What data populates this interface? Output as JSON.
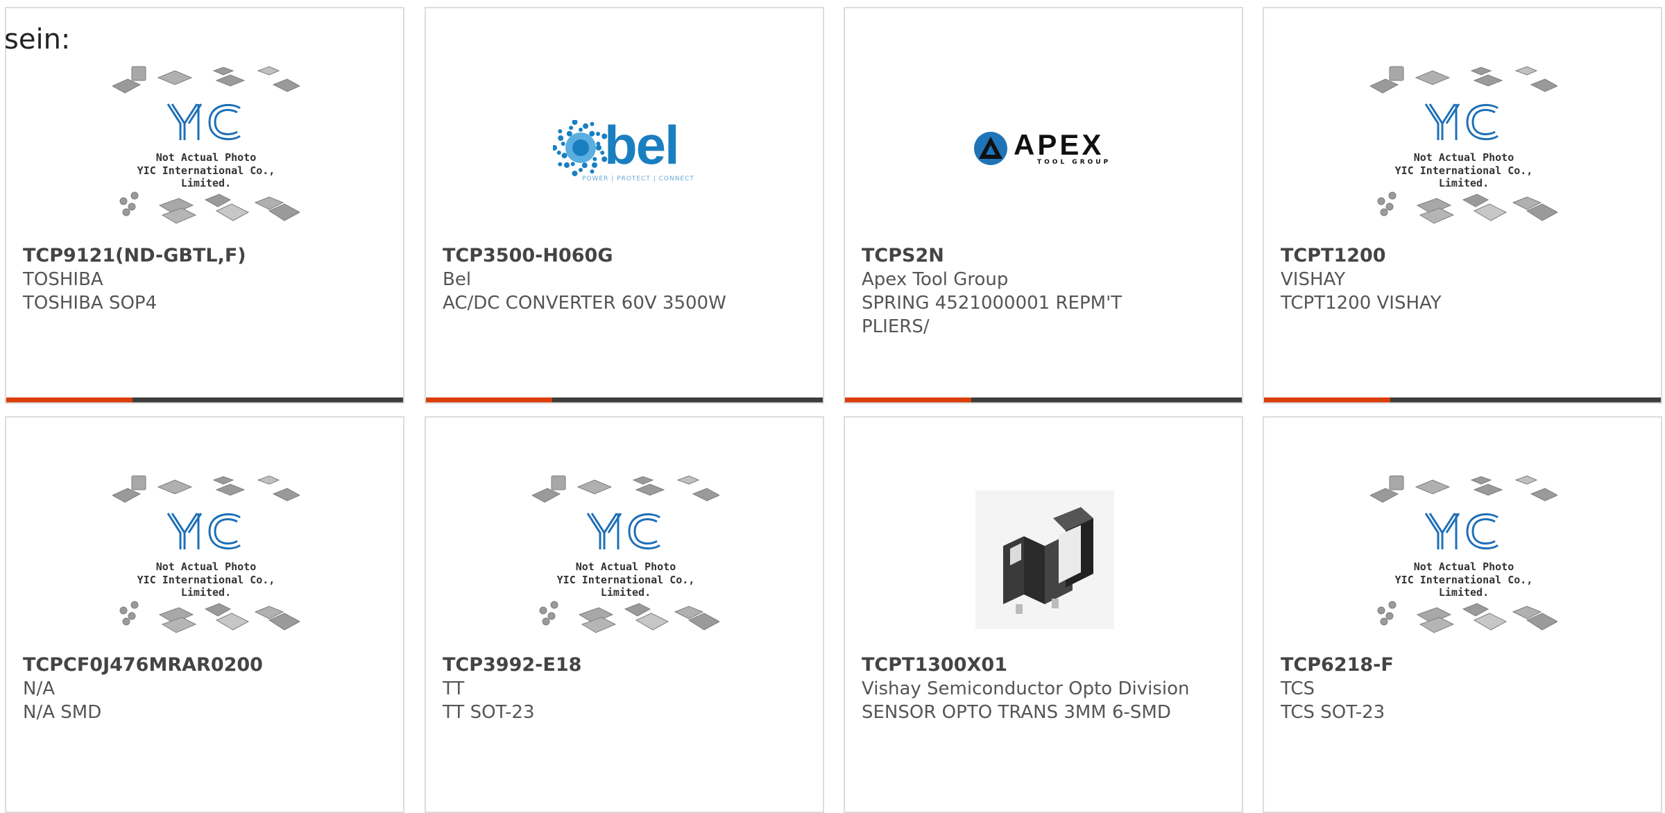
{
  "heading": "sein:",
  "placeholder": {
    "line1": "Not Actual Photo",
    "line2": "YIC International Co., Limited.",
    "logo_text": "YIC"
  },
  "logos": {
    "bel": {
      "word": "bel",
      "tagline": "POWER | PROTECT | CONNECT"
    },
    "apex": {
      "word": "APEX",
      "sub": "TOOL GROUP"
    }
  },
  "colors": {
    "accent": "#d9400b",
    "bar": "#3e3e3e",
    "yic_blue": "#1e6fb8",
    "bel_blue": "#1a7fc1"
  },
  "products": [
    {
      "part": "TCP9121(ND-GBTL,F)",
      "maker": "TOSHIBA",
      "desc": "TOSHIBA SOP4",
      "image": "yic-placeholder"
    },
    {
      "part": "TCP3500-H060G",
      "maker": "Bel",
      "desc": "AC/DC CONVERTER 60V 3500W",
      "image": "bel-logo"
    },
    {
      "part": "TCPS2N",
      "maker": "Apex Tool Group",
      "desc": "SPRING 4521000001 REPM'T PLIERS/",
      "image": "apex-logo"
    },
    {
      "part": "TCPT1200",
      "maker": "VISHAY",
      "desc": "TCPT1200 VISHAY",
      "image": "yic-placeholder"
    },
    {
      "part": "TCPCF0J476MRAR0200",
      "maker": "N/A",
      "desc": "N/A SMD",
      "image": "yic-placeholder"
    },
    {
      "part": "TCP3992-E18",
      "maker": "TT",
      "desc": "TT SOT-23",
      "image": "yic-placeholder"
    },
    {
      "part": "TCPT1300X01",
      "maker": "Vishay Semiconductor Opto Division",
      "desc": "SENSOR OPTO TRANS 3MM 6-SMD",
      "image": "sensor-photo"
    },
    {
      "part": "TCP6218-F",
      "maker": "TCS",
      "desc": "TCS SOT-23",
      "image": "yic-placeholder"
    }
  ]
}
